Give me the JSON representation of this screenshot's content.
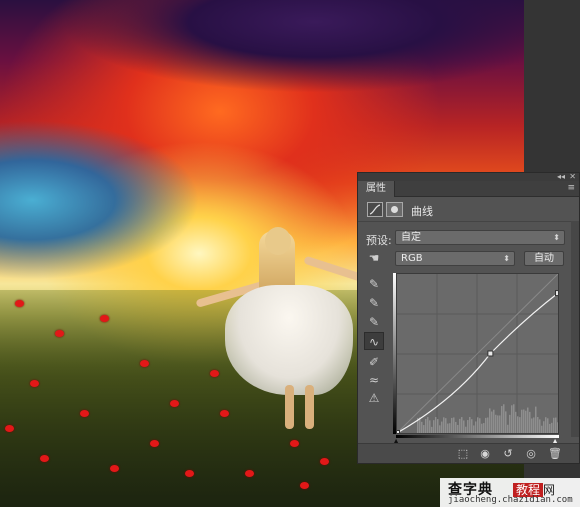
{
  "panel": {
    "tab_label": "属性",
    "collapse_glyph": "◂◂",
    "close_glyph": "✕",
    "menu_glyph": "≡",
    "adjustment_title": "曲线",
    "preset_label": "预设:",
    "preset_value": "自定",
    "channel_value": "RGB",
    "auto_button": "自动"
  },
  "curves": {
    "points": [
      [
        0,
        0
      ],
      [
        0.58,
        0.5
      ],
      [
        1,
        0.88
      ]
    ]
  },
  "watermark": {
    "title": "查字典",
    "net_label": "教程",
    "net_suffix": "网",
    "url": "jiaocheng.chazidian.com"
  },
  "colors": {
    "panel_bg": "#535353",
    "graph_bg": "#6a6a6a",
    "poppy": "#e21818"
  }
}
